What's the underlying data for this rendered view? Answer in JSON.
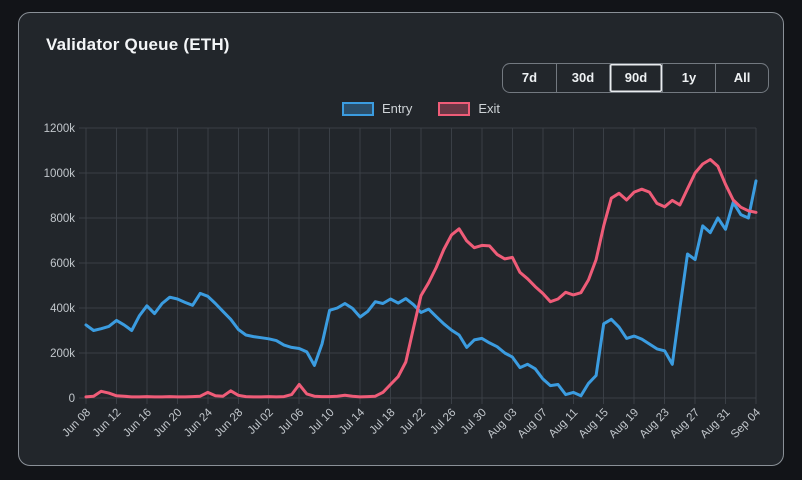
{
  "card": {
    "title": "Validator Queue (ETH)"
  },
  "range_buttons": {
    "options": [
      "7d",
      "30d",
      "90d",
      "1y",
      "All"
    ],
    "active": "90d"
  },
  "legend": {
    "entries": [
      {
        "label": "Entry",
        "color": "#3b9ce0",
        "fill": "rgba(59,156,224,0.35)"
      },
      {
        "label": "Exit",
        "color": "#ef5c78",
        "fill": "rgba(239,92,120,0.35)"
      }
    ]
  },
  "colors": {
    "page_bg": "#121418",
    "card_bg": "#22262b",
    "card_border": "#8a9097",
    "grid": "#3a3f46",
    "axis_text": "#c2c7cc",
    "title_text": "#f3f5f7",
    "entry_line": "#3b9ce0",
    "exit_line": "#ef5c78"
  },
  "chart_data": {
    "type": "line",
    "title": "Validator Queue (ETH)",
    "unit": "k",
    "ylim": [
      0,
      1200
    ],
    "y_ticks": [
      0,
      200,
      400,
      600,
      800,
      1000,
      1200
    ],
    "grid": true,
    "legend_position": "top",
    "x_label_every": 4,
    "x_labels": [
      "Jun 08",
      "Jun 12",
      "Jun 16",
      "Jun 20",
      "Jun 24",
      "Jun 28",
      "Jul 02",
      "Jul 06",
      "Jul 10",
      "Jul 14",
      "Jul 18",
      "Jul 22",
      "Jul 26",
      "Jul 30",
      "Aug 03",
      "Aug 07",
      "Aug 11",
      "Aug 15",
      "Aug 19",
      "Aug 23",
      "Aug 27",
      "Aug 31",
      "Sep 04"
    ],
    "grid_color": "#3a3f46",
    "label_color": "#c2c7cc",
    "series": [
      {
        "name": "Entry",
        "color": "#3b9ce0",
        "values": [
          325,
          300,
          308,
          318,
          345,
          325,
          300,
          365,
          410,
          375,
          420,
          448,
          440,
          425,
          412,
          465,
          452,
          420,
          385,
          350,
          305,
          280,
          273,
          268,
          263,
          255,
          235,
          225,
          220,
          205,
          145,
          240,
          390,
          400,
          420,
          398,
          360,
          385,
          428,
          420,
          440,
          422,
          442,
          415,
          380,
          395,
          362,
          330,
          302,
          280,
          225,
          258,
          265,
          245,
          228,
          200,
          182,
          135,
          150,
          130,
          85,
          55,
          60,
          15,
          25,
          10,
          65,
          100,
          330,
          350,
          315,
          265,
          275,
          262,
          240,
          218,
          210,
          150,
          400,
          640,
          615,
          765,
          735,
          800,
          750,
          870,
          815,
          800,
          965
        ]
      },
      {
        "name": "Exit",
        "color": "#ef5c78",
        "values": [
          5,
          8,
          30,
          22,
          10,
          8,
          5,
          5,
          6,
          5,
          5,
          6,
          5,
          5,
          6,
          8,
          25,
          10,
          8,
          32,
          12,
          6,
          5,
          5,
          6,
          5,
          6,
          15,
          60,
          18,
          8,
          6,
          6,
          8,
          12,
          8,
          5,
          6,
          8,
          25,
          60,
          95,
          160,
          310,
          455,
          512,
          580,
          660,
          725,
          752,
          698,
          668,
          678,
          676,
          638,
          618,
          625,
          558,
          530,
          495,
          465,
          428,
          440,
          470,
          458,
          468,
          525,
          615,
          765,
          888,
          910,
          880,
          915,
          928,
          915,
          865,
          850,
          878,
          858,
          930,
          1000,
          1040,
          1060,
          1030,
          950,
          880,
          848,
          832,
          825
        ]
      }
    ]
  }
}
